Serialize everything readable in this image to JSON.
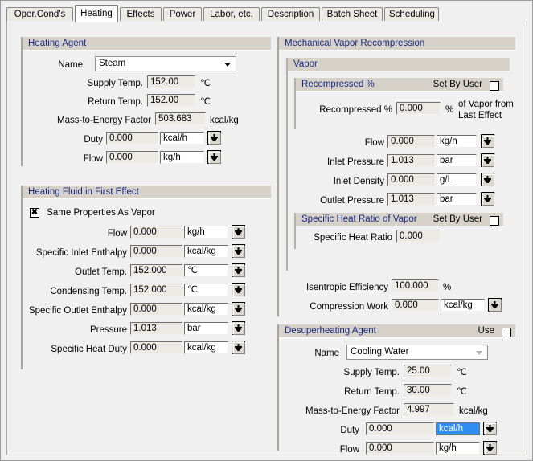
{
  "tabs": [
    {
      "label": "Oper.Cond's",
      "active": false
    },
    {
      "label": "Heating",
      "active": true
    },
    {
      "label": "Effects",
      "active": false
    },
    {
      "label": "Power",
      "active": false
    },
    {
      "label": "Labor, etc.",
      "active": false
    },
    {
      "label": "Description",
      "active": false
    },
    {
      "label": "Batch Sheet",
      "active": false
    },
    {
      "label": "Scheduling",
      "active": false
    }
  ],
  "heating_agent": {
    "title": "Heating Agent",
    "name_label": "Name",
    "name_value": "Steam",
    "supply_temp_label": "Supply Temp.",
    "supply_temp_value": "152.00",
    "supply_temp_unit": "℃",
    "return_temp_label": "Return Temp.",
    "return_temp_value": "152.00",
    "return_temp_unit": "℃",
    "mef_label": "Mass-to-Energy Factor",
    "mef_value": "503.683",
    "mef_unit": "kcal/kg",
    "duty_label": "Duty",
    "duty_value": "0.000",
    "duty_unit": "kcal/h",
    "flow_label": "Flow",
    "flow_value": "0.000",
    "flow_unit": "kg/h"
  },
  "heating_fluid": {
    "title": "Heating Fluid in First Effect",
    "same_props_label": "Same Properties As Vapor",
    "same_props_checked": true,
    "flow_label": "Flow",
    "flow_value": "0.000",
    "flow_unit": "kg/h",
    "inlet_enthalpy_label": "Specific Inlet Enthalpy",
    "inlet_enthalpy_value": "0.000",
    "inlet_enthalpy_unit": "kcal/kg",
    "outlet_temp_label": "Outlet Temp.",
    "outlet_temp_value": "152.000",
    "outlet_temp_unit": "℃",
    "condensing_temp_label": "Condensing Temp.",
    "condensing_temp_value": "152.000",
    "condensing_temp_unit": "℃",
    "outlet_enthalpy_label": "Specific Outlet Enthalpy",
    "outlet_enthalpy_value": "0.000",
    "outlet_enthalpy_unit": "kcal/kg",
    "pressure_label": "Pressure",
    "pressure_value": "1.013",
    "pressure_unit": "bar",
    "heat_duty_label": "Specific Heat Duty",
    "heat_duty_value": "0.000",
    "heat_duty_unit": "kcal/kg"
  },
  "mvr": {
    "title": "Mechanical Vapor Recompression",
    "vapor": {
      "title": "Vapor",
      "recompressed": {
        "title": "Recompressed %",
        "set_by_user_label": "Set By User",
        "set_by_user_checked": false,
        "field_label": "Recompressed %",
        "value": "0.000",
        "unit": "%",
        "note_line1": "of Vapor from",
        "note_line2": "Last Effect"
      },
      "flow_label": "Flow",
      "flow_value": "0.000",
      "flow_unit": "kg/h",
      "inlet_pressure_label": "Inlet Pressure",
      "inlet_pressure_value": "1.013",
      "inlet_pressure_unit": "bar",
      "inlet_density_label": "Inlet Density",
      "inlet_density_value": "0.000",
      "inlet_density_unit": "g/L",
      "outlet_pressure_label": "Outlet Pressure",
      "outlet_pressure_value": "1.013",
      "outlet_pressure_unit": "bar",
      "shr": {
        "title": "Specific Heat Ratio of Vapor",
        "set_by_user_label": "Set By User",
        "set_by_user_checked": false,
        "field_label": "Specific Heat Ratio",
        "value": "0.000"
      }
    },
    "isentropic_label": "Isentropic Efficiency",
    "isentropic_value": "100.000",
    "isentropic_unit": "%",
    "compression_label": "Compression Work",
    "compression_value": "0.000",
    "compression_unit": "kcal/kg"
  },
  "desuperheating": {
    "title": "Desuperheating Agent",
    "use_label": "Use",
    "use_checked": false,
    "name_label": "Name",
    "name_value": "Cooling Water",
    "supply_temp_label": "Supply Temp.",
    "supply_temp_value": "25.00",
    "supply_temp_unit": "℃",
    "return_temp_label": "Return Temp.",
    "return_temp_value": "30.00",
    "return_temp_unit": "℃",
    "mef_label": "Mass-to-Energy Factor",
    "mef_value": "4.997",
    "mef_unit": "kcal/kg",
    "duty_label": "Duty",
    "duty_value": "0.000",
    "duty_unit": "kcal/h",
    "duty_unit_selected": true,
    "flow_label": "Flow",
    "flow_value": "0.000",
    "flow_unit": "kg/h"
  },
  "colors": {
    "header_text": "#1b2a80",
    "header_bar": "#d6d2ca",
    "selection": "#2f8ef0",
    "page_bg": "#f0f0f0"
  }
}
